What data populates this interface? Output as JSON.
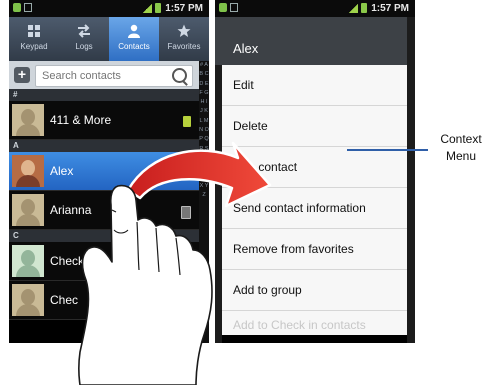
{
  "left_screen": {
    "status_time": "1:57 PM",
    "tabs": [
      {
        "label": "Keypad",
        "icon": "keypad-icon",
        "active": false
      },
      {
        "label": "Logs",
        "icon": "logs-icon",
        "active": false
      },
      {
        "label": "Contacts",
        "icon": "contacts-icon",
        "active": true
      },
      {
        "label": "Favorites",
        "icon": "star-icon",
        "active": false
      }
    ],
    "search_placeholder": "Search contacts",
    "index_letters": "# A B C D E F G H I J K L M N O P Q R S T U V W X Y Z",
    "sections": [
      {
        "header": "#",
        "contacts": [
          {
            "name": "411 & More",
            "badge": "sim"
          }
        ]
      },
      {
        "header": "A",
        "contacts": [
          {
            "name": "Alex",
            "badge": "account",
            "selected": true
          },
          {
            "name": "Arianna",
            "badge": "account"
          }
        ]
      },
      {
        "header": "C",
        "contacts": [
          {
            "name": "Check",
            "badge": "sim"
          },
          {
            "name": "Chec",
            "badge": "sim"
          }
        ]
      }
    ]
  },
  "right_screen": {
    "status_time": "1:57 PM",
    "title": "Alex",
    "menu_items": [
      "Edit",
      "Delete",
      "Join contact",
      "Send contact information",
      "Remove from favorites",
      "Add to group",
      "Add to Check in contacts"
    ]
  },
  "callout": {
    "text_line1": "Context",
    "text_line2": "Menu"
  },
  "colors": {
    "accent_blue": "#2f6fc4",
    "swipe_arrow": "#e8352c",
    "callout_line": "#2f5fa8"
  }
}
